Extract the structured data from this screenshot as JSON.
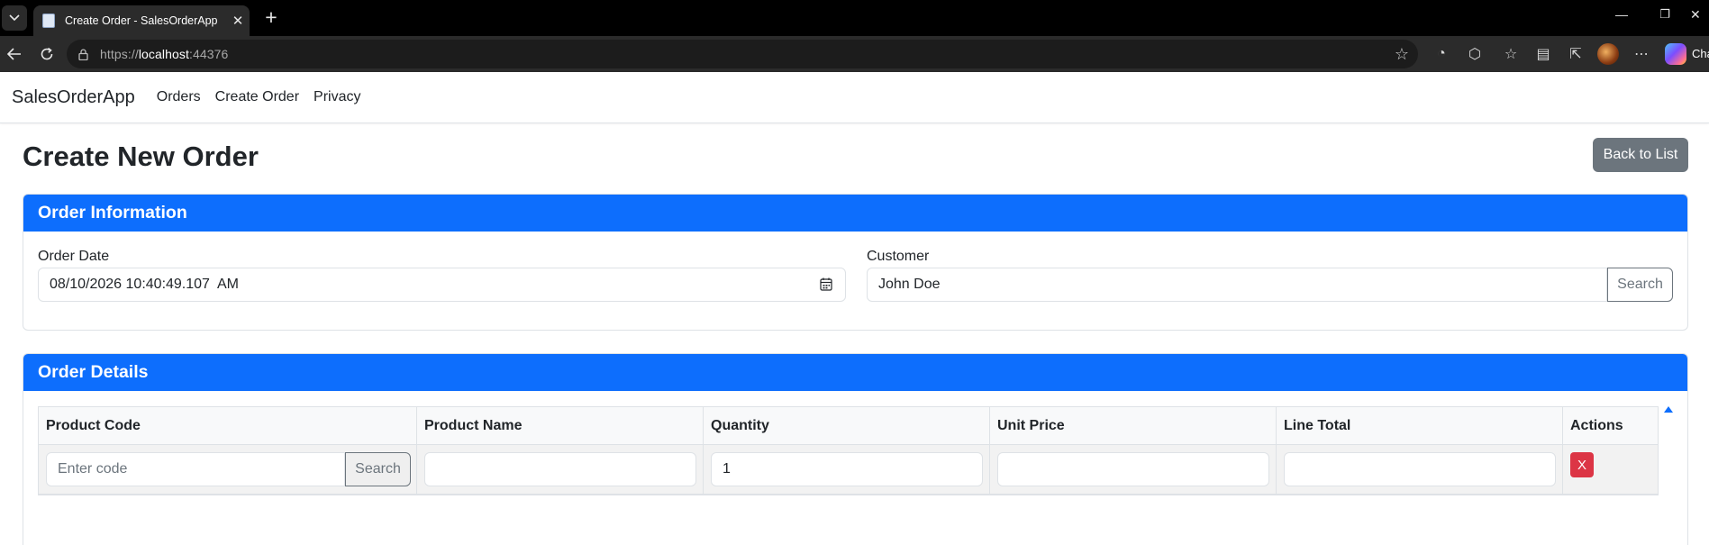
{
  "browser": {
    "tab_title": "Create Order - SalesOrderApp",
    "url_prefix": "https://",
    "url_host": "localhost",
    "url_port": ":44376",
    "copilot_label": "Cha"
  },
  "navbar": {
    "brand": "SalesOrderApp",
    "links": [
      "Orders",
      "Create Order",
      "Privacy"
    ]
  },
  "page": {
    "title": "Create New Order",
    "back_button": "Back to List"
  },
  "order_info": {
    "header": "Order Information",
    "order_date_label": "Order Date",
    "order_date_value": "08/10/2026 10:40:49.107  AM",
    "customer_label": "Customer",
    "customer_value": "John Doe",
    "customer_search_button": "Search"
  },
  "order_details": {
    "header": "Order Details",
    "columns": [
      "Product Code",
      "Product Name",
      "Quantity",
      "Unit Price",
      "Line Total",
      "Actions"
    ],
    "row": {
      "product_code_placeholder": "Enter code",
      "product_search_button": "Search",
      "product_name": "",
      "quantity": "1",
      "unit_price": "",
      "line_total": "",
      "remove_button": "X"
    }
  },
  "colors": {
    "primary": "#0d6efd",
    "secondary": "#6c757d",
    "danger": "#dc3545"
  }
}
